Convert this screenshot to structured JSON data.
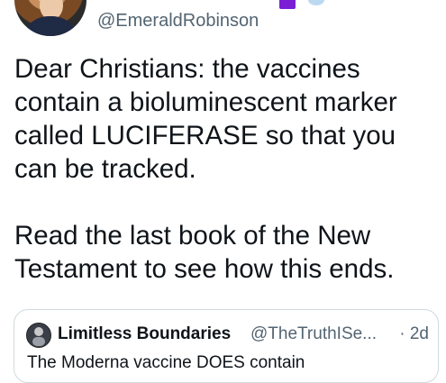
{
  "author": {
    "handle": "@EmeraldRobinson"
  },
  "tweet": {
    "paragraph_1": "Dear Christians: the vaccines contain a bioluminescent marker called LUCIFERASE so that you can be tracked.",
    "paragraph_2": "Read the last book of the New Testament to see how this ends."
  },
  "quoted_tweet": {
    "display_name": "Limitless Boundaries",
    "handle": "@TheTruthISe...",
    "separator_time": "· 2d",
    "body_preview": "The Moderna vaccine DOES contain"
  },
  "colors": {
    "text": "#0f1419",
    "secondary_text": "#536471",
    "border": "#cfd9de",
    "badge": "#7b1fd6"
  },
  "icons": [
    "avatar",
    "verified-badge-icon",
    "quoted-avatar"
  ]
}
